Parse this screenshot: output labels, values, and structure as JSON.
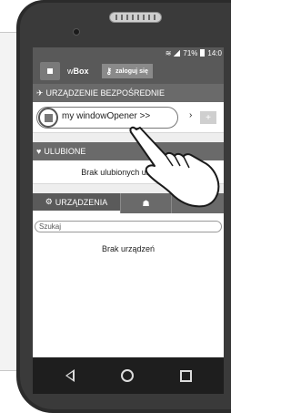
{
  "status_bar": {
    "wifi_icon": "wifi-icon",
    "signal_icon": "signal-icon",
    "battery_text": "71%",
    "time": "14:0"
  },
  "app_bar": {
    "logo_icon": "wbox-logo-icon",
    "title_prefix": "w",
    "title_bold": "Box",
    "login_label": "zaloguj się"
  },
  "direct_section": {
    "header": "URZĄDZENIE BEZPOŚREDNIE",
    "device_name": "my windowOpener >>",
    "arrow": "›",
    "add_label": "+"
  },
  "favorites_section": {
    "header": "ULUBIONE",
    "empty_text": "Brak ulubionych urządzeń"
  },
  "tabs": [
    {
      "label": "URZĄDZENIA",
      "icon": "gear-icon"
    },
    {
      "label": "",
      "icon": "group-icon"
    },
    {
      "label": "",
      "icon": "scene-icon"
    }
  ],
  "search": {
    "placeholder": "Szukaj",
    "value": ""
  },
  "devices_empty_text": "Brak urządzeń",
  "colors": {
    "bar_dark": "#595959",
    "section_header": "#6a6a6a",
    "screen_bg": "#ffffff",
    "phone_body": "#2b2b2b"
  }
}
